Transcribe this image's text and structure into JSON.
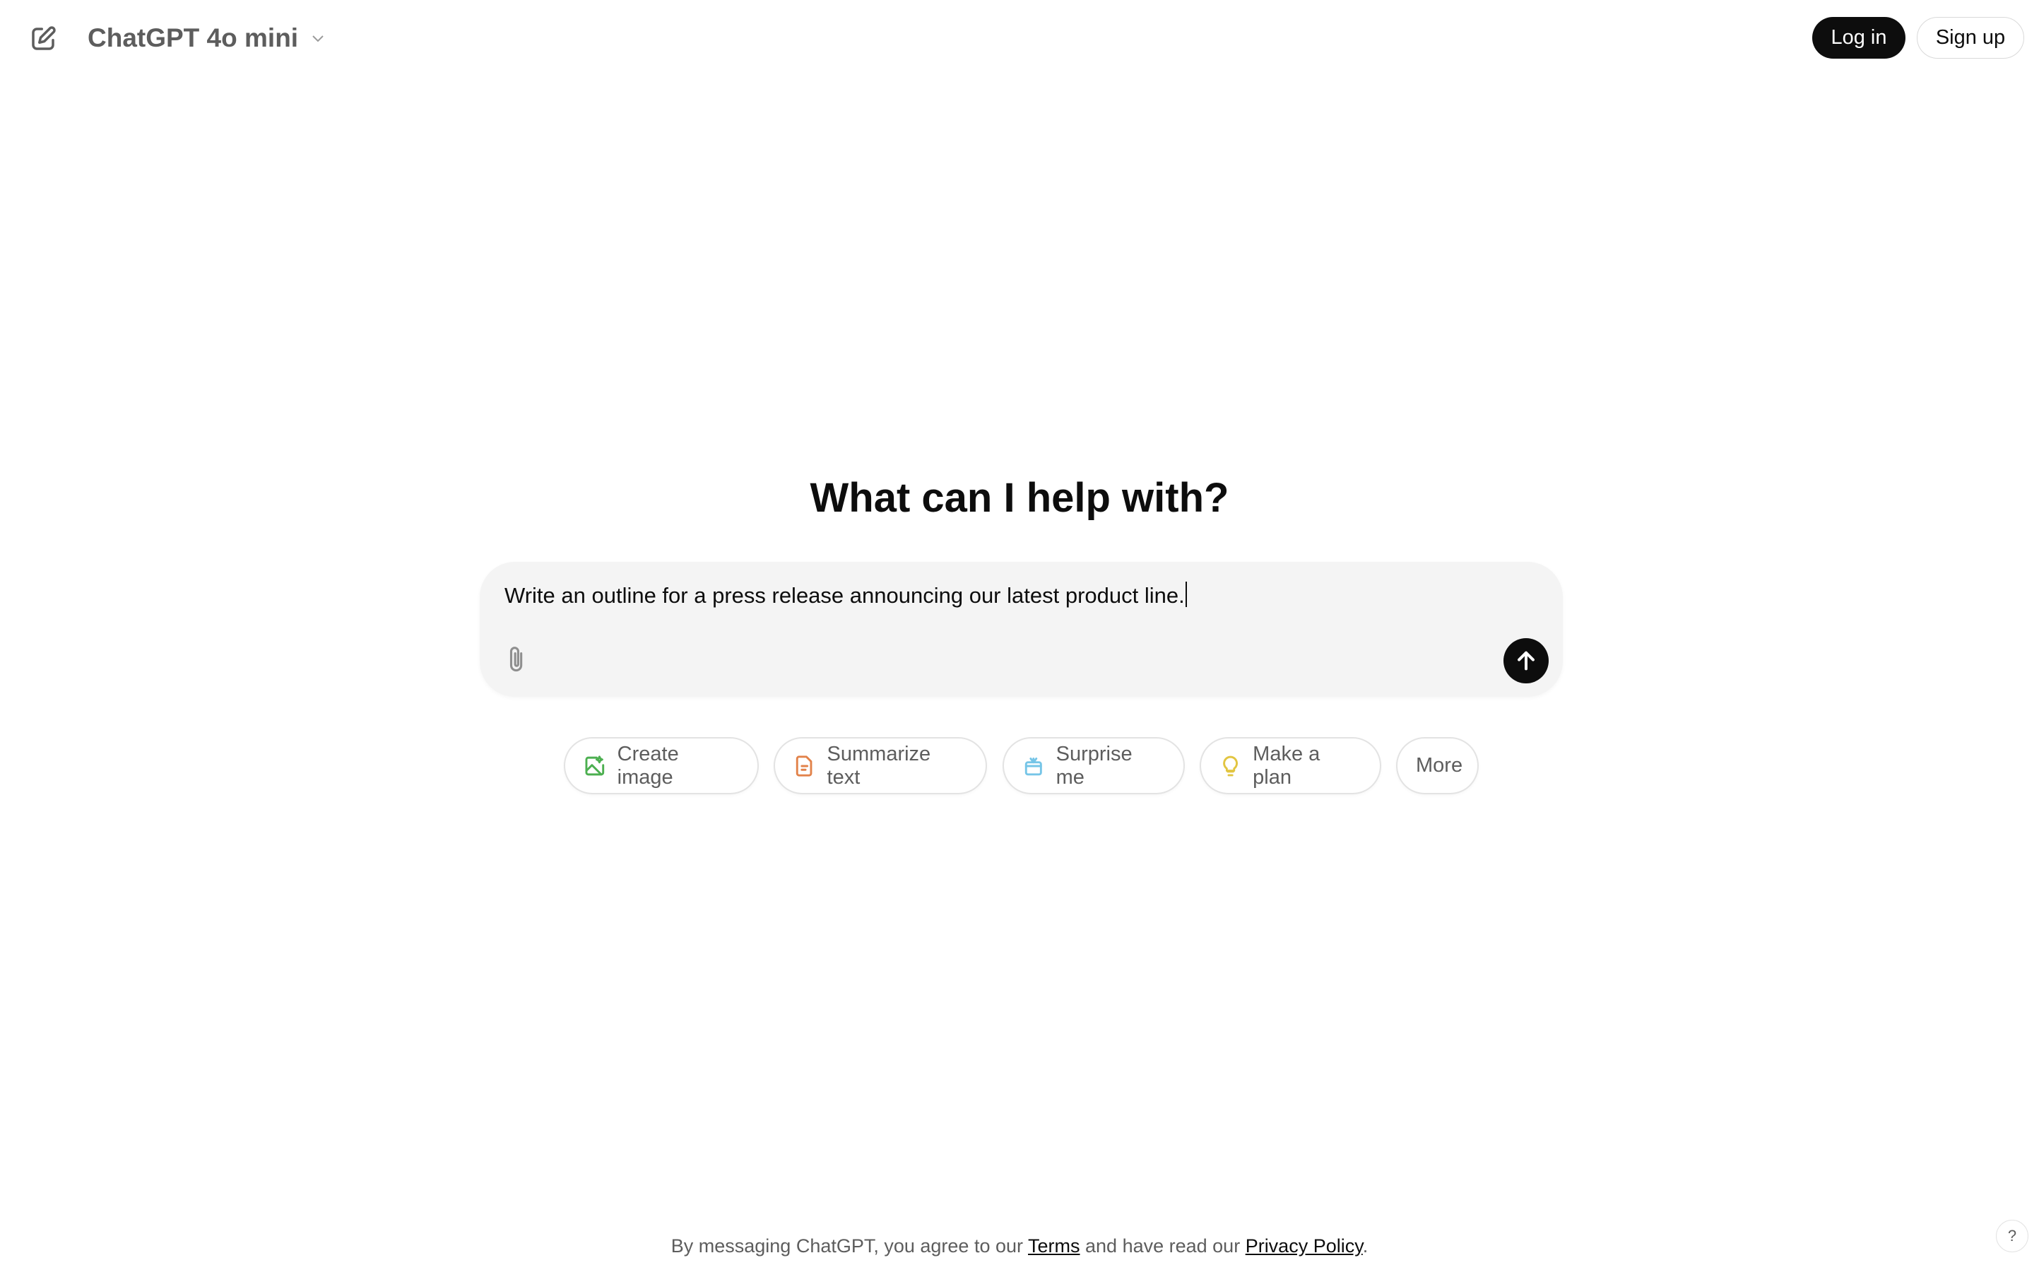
{
  "header": {
    "new_chat_icon": "edit-icon",
    "model_name": "ChatGPT 4o mini",
    "login_label": "Log in",
    "signup_label": "Sign up"
  },
  "main": {
    "heading": "What can I help with?",
    "composer": {
      "value": "Write an outline for a press release announcing our latest product line.",
      "attach_icon": "paperclip-icon",
      "send_icon": "arrow-up-icon"
    },
    "suggestions": [
      {
        "label": "Create image",
        "icon": "image-icon",
        "color": "#4caf50"
      },
      {
        "label": "Summarize text",
        "icon": "document-icon",
        "color": "#e2824a"
      },
      {
        "label": "Surprise me",
        "icon": "gift-icon",
        "color": "#76c5e7"
      },
      {
        "label": "Make a plan",
        "icon": "lightbulb-icon",
        "color": "#e2c541"
      },
      {
        "label": "More"
      }
    ]
  },
  "footer": {
    "prefix": "By messaging ChatGPT, you agree to our ",
    "terms": "Terms",
    "middle": " and have read our ",
    "privacy": "Privacy Policy",
    "suffix": ".",
    "help_label": "?"
  }
}
